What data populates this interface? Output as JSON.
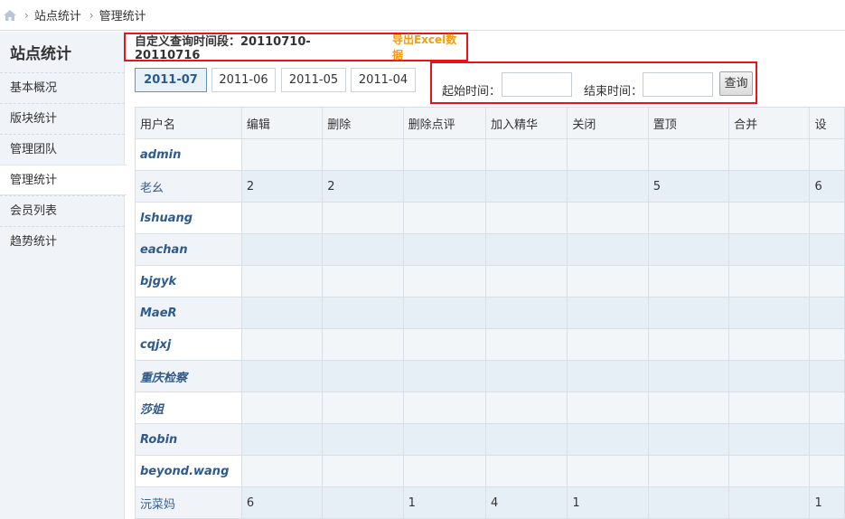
{
  "breadcrumb": [
    "站点统计",
    "管理统计"
  ],
  "sidebar": {
    "title": "站点统计",
    "items": [
      {
        "label": "基本概况",
        "active": false
      },
      {
        "label": "版块统计",
        "active": false
      },
      {
        "label": "管理团队",
        "active": false
      },
      {
        "label": "管理统计",
        "active": true
      },
      {
        "label": "会员列表",
        "active": false
      },
      {
        "label": "趋势统计",
        "active": false
      }
    ]
  },
  "period": {
    "text": "自定义查询时间段：20110710-20110716",
    "export_label": "导出Excel数据"
  },
  "months": [
    {
      "label": "2011-07",
      "active": true
    },
    {
      "label": "2011-06",
      "active": false
    },
    {
      "label": "2011-05",
      "active": false
    },
    {
      "label": "2011-04",
      "active": false
    }
  ],
  "query": {
    "start_label": "起始时间：",
    "end_label": "结束时间：",
    "start_value": "",
    "end_value": "",
    "button_label": "查询"
  },
  "table": {
    "headers": [
      "用户名",
      "编辑",
      "删除",
      "删除点评",
      "加入精华",
      "关闭",
      "置顶",
      "合并",
      "设"
    ],
    "rows": [
      {
        "user": "admin",
        "styled": true,
        "cells": [
          "",
          "",
          "",
          "",
          "",
          "",
          "",
          ""
        ]
      },
      {
        "user": "老幺",
        "styled": false,
        "cells": [
          "2",
          "2",
          "",
          "",
          "",
          "5",
          "",
          "6"
        ]
      },
      {
        "user": "lshuang",
        "styled": true,
        "cells": [
          "",
          "",
          "",
          "",
          "",
          "",
          "",
          ""
        ]
      },
      {
        "user": "eachan",
        "styled": true,
        "cells": [
          "",
          "",
          "",
          "",
          "",
          "",
          "",
          ""
        ]
      },
      {
        "user": "bjgyk",
        "styled": true,
        "cells": [
          "",
          "",
          "",
          "",
          "",
          "",
          "",
          ""
        ]
      },
      {
        "user": "MaeR",
        "styled": true,
        "cells": [
          "",
          "",
          "",
          "",
          "",
          "",
          "",
          ""
        ]
      },
      {
        "user": "cqjxj",
        "styled": true,
        "cells": [
          "",
          "",
          "",
          "",
          "",
          "",
          "",
          ""
        ]
      },
      {
        "user": "重庆检察",
        "styled": true,
        "cells": [
          "",
          "",
          "",
          "",
          "",
          "",
          "",
          ""
        ]
      },
      {
        "user": "莎姐",
        "styled": true,
        "cells": [
          "",
          "",
          "",
          "",
          "",
          "",
          "",
          ""
        ]
      },
      {
        "user": "Robin",
        "styled": true,
        "cells": [
          "",
          "",
          "",
          "",
          "",
          "",
          "",
          ""
        ]
      },
      {
        "user": "beyond.wang",
        "styled": true,
        "cells": [
          "",
          "",
          "",
          "",
          "",
          "",
          "",
          ""
        ]
      },
      {
        "user": "沅菜妈",
        "styled": false,
        "cells": [
          "6",
          "",
          "1",
          "4",
          "1",
          "",
          "",
          "1"
        ]
      }
    ]
  },
  "colors": {
    "highlight_border": "#e8141a",
    "export_link": "#f39c12",
    "user_link": "#2f5a8a"
  }
}
